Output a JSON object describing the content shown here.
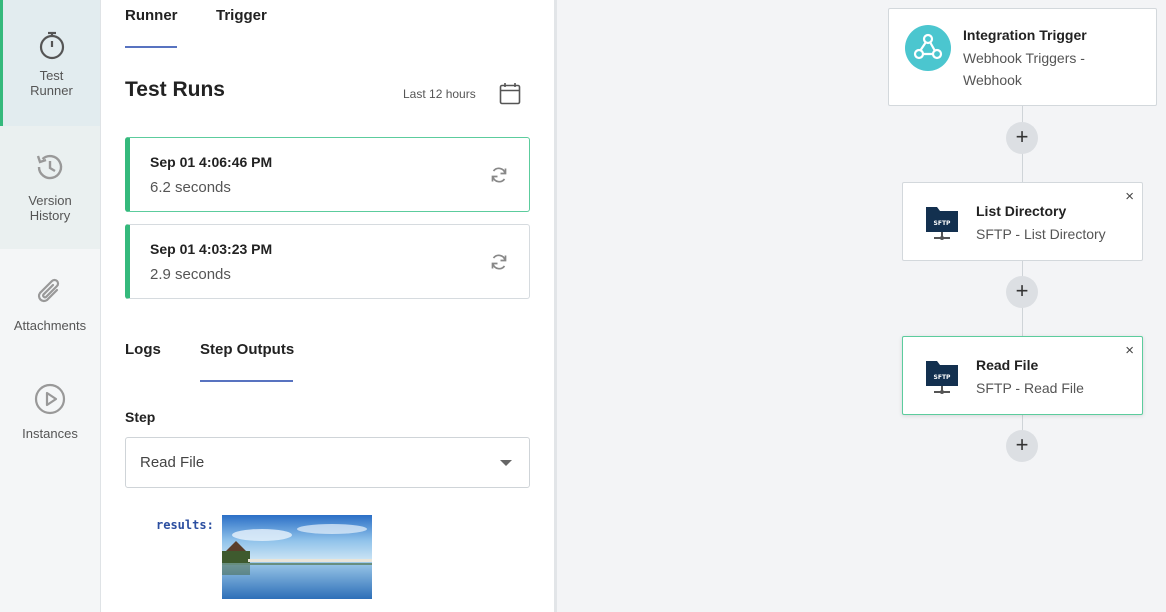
{
  "nav": {
    "items": [
      {
        "label_line1": "Test",
        "label_line2": "Runner"
      },
      {
        "label_line1": "Version",
        "label_line2": "History"
      },
      {
        "label_line1": "Attachments",
        "label_line2": ""
      },
      {
        "label_line1": "Instances",
        "label_line2": ""
      }
    ]
  },
  "panel": {
    "tabs": {
      "runner": "Runner",
      "trigger": "Trigger"
    },
    "title": "Test Runs",
    "time_range": "Last 12 hours",
    "runs": [
      {
        "time": "Sep 01 4:06:46 PM",
        "duration": "6.2 seconds"
      },
      {
        "time": "Sep 01 4:03:23 PM",
        "duration": "2.9 seconds"
      }
    ],
    "output_tabs": {
      "logs": "Logs",
      "step_outputs": "Step Outputs"
    },
    "step_label": "Step",
    "step_select_value": "Read File",
    "results_key": "results:"
  },
  "canvas": {
    "trigger_card": {
      "title": "Integration Trigger",
      "subtitle_line1": "Webhook Triggers -",
      "subtitle_line2": "Webhook"
    },
    "steps": [
      {
        "title": "List Directory",
        "subtitle": "SFTP - List Directory",
        "icon_text": "SFTP"
      },
      {
        "title": "Read File",
        "subtitle": "SFTP - Read File",
        "icon_text": "SFTP"
      }
    ],
    "plus_symbol": "+",
    "close_symbol": "×"
  },
  "colors": {
    "accent_green": "#35b97c",
    "accent_blue": "#5873c0",
    "webhook_teal": "#4bc6cf",
    "sftp_navy": "#13304f"
  }
}
